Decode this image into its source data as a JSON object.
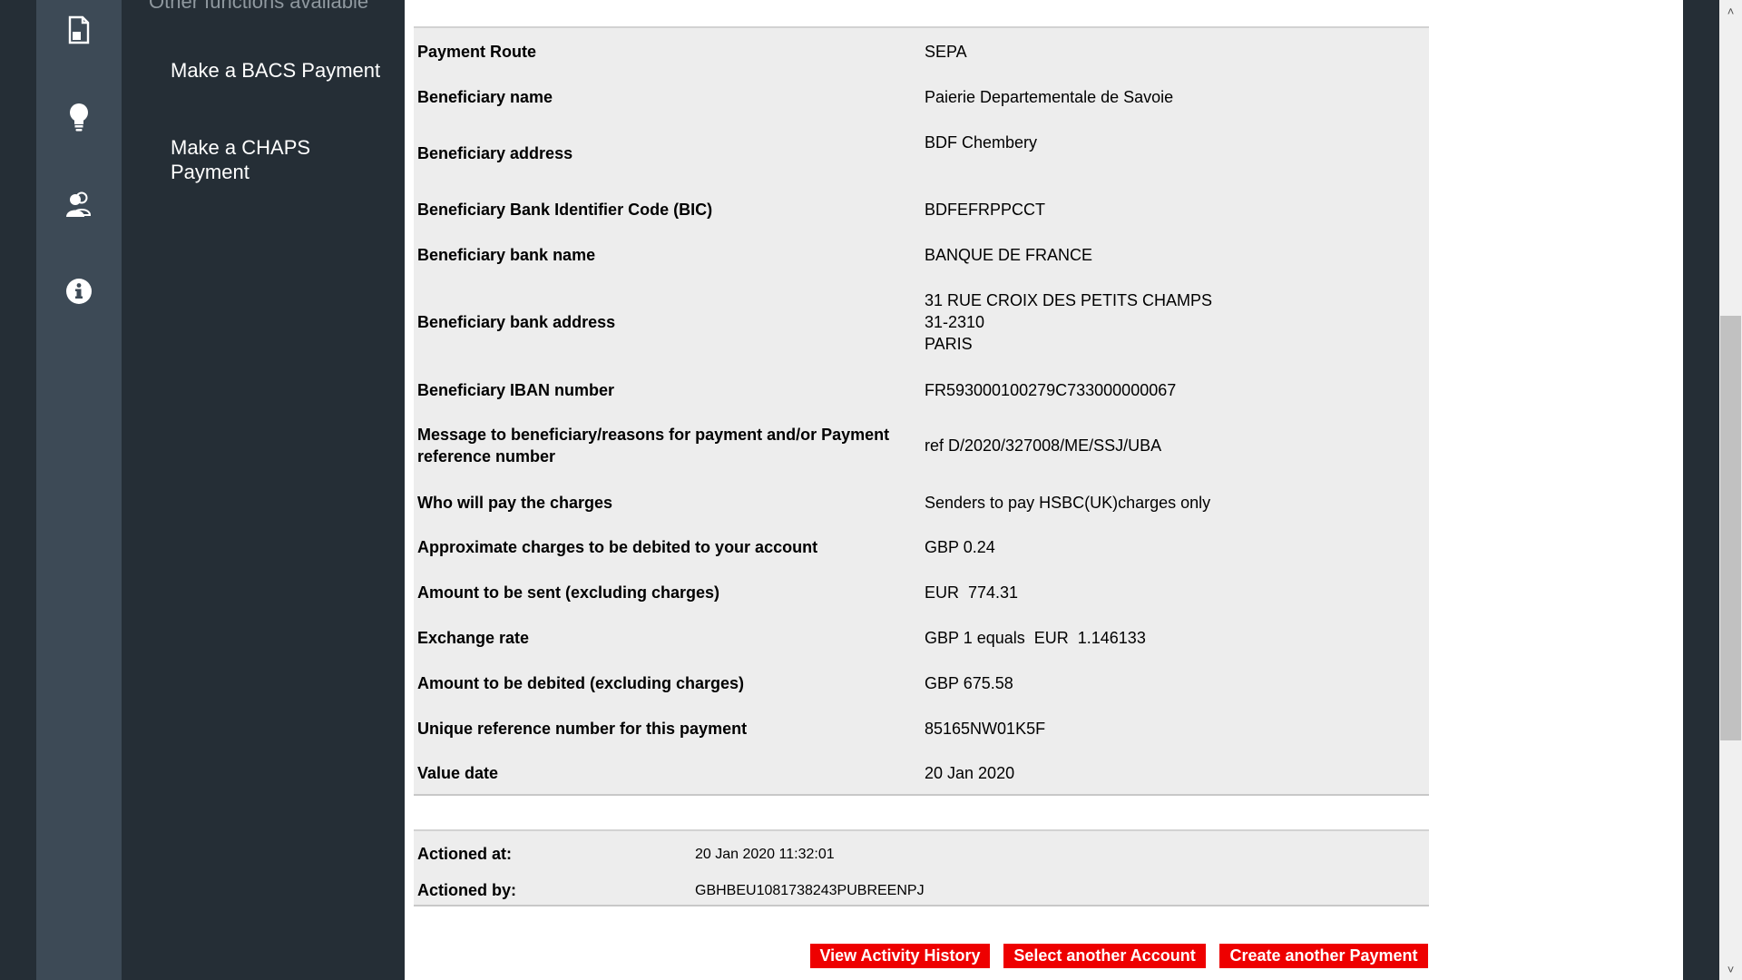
{
  "sidebar": {
    "heading": "Other functions available",
    "links": [
      {
        "label": "Make a BACS Payment"
      },
      {
        "label": "Make a CHAPS Payment"
      }
    ]
  },
  "rail_icons": [
    "document-icon",
    "lightbulb-icon",
    "users-icon",
    "info-icon"
  ],
  "details": [
    {
      "label": "Payment Route",
      "value": "SEPA"
    },
    {
      "label": "Beneficiary name",
      "value": "Paierie Departementale de Savoie"
    },
    {
      "label": "Beneficiary address",
      "value": "BDF Chembery"
    },
    {
      "label": "Beneficiary Bank Identifier Code (BIC)",
      "value": "BDFEFRPPCCT"
    },
    {
      "label": "Beneficiary bank name",
      "value": "BANQUE DE FRANCE"
    },
    {
      "label": "Beneficiary bank address",
      "value_lines": [
        "31 RUE CROIX DES PETITS CHAMPS",
        "31-2310",
        "PARIS"
      ]
    },
    {
      "label": "Beneficiary IBAN number",
      "value": "FR593000100279C733000000067"
    },
    {
      "label_lines": [
        "Message to beneficiary/reasons for payment and/or Payment",
        "reference number"
      ],
      "value": "ref D/2020/327008/ME/SSJ/UBA"
    },
    {
      "label": "Who will pay the charges",
      "value": "Senders to pay HSBC(UK)charges only"
    },
    {
      "label": "Approximate charges to be debited to your account",
      "value": "GBP 0.24"
    },
    {
      "label": "Amount to be sent (excluding charges)",
      "value": "EUR  774.31"
    },
    {
      "label": "Exchange rate",
      "value": "GBP 1 equals  EUR  1.146133"
    },
    {
      "label": "Amount to be debited (excluding charges)",
      "value": "GBP 675.58"
    },
    {
      "label": "Unique reference number for this payment",
      "value": "85165NW01K5F"
    },
    {
      "label": "Value date",
      "value": "20 Jan 2020"
    }
  ],
  "actioned": {
    "at_label": "Actioned at:",
    "at_value": "20 Jan 2020 11:32:01",
    "by_label": "Actioned by:",
    "by_value": "GBHBEU1081738243PUBREENPJ"
  },
  "buttons": {
    "view_history": "View Activity History",
    "select_account": "Select another Account",
    "create_payment": "Create another Payment"
  },
  "colors": {
    "accent_button": "#ee0000",
    "sidebar_bg": "#252e36",
    "rail_bg": "#3d4a56",
    "panel_bg": "#ededed"
  },
  "scrollbar": {
    "up_arrow": "˄",
    "down_arrow": "˅"
  }
}
